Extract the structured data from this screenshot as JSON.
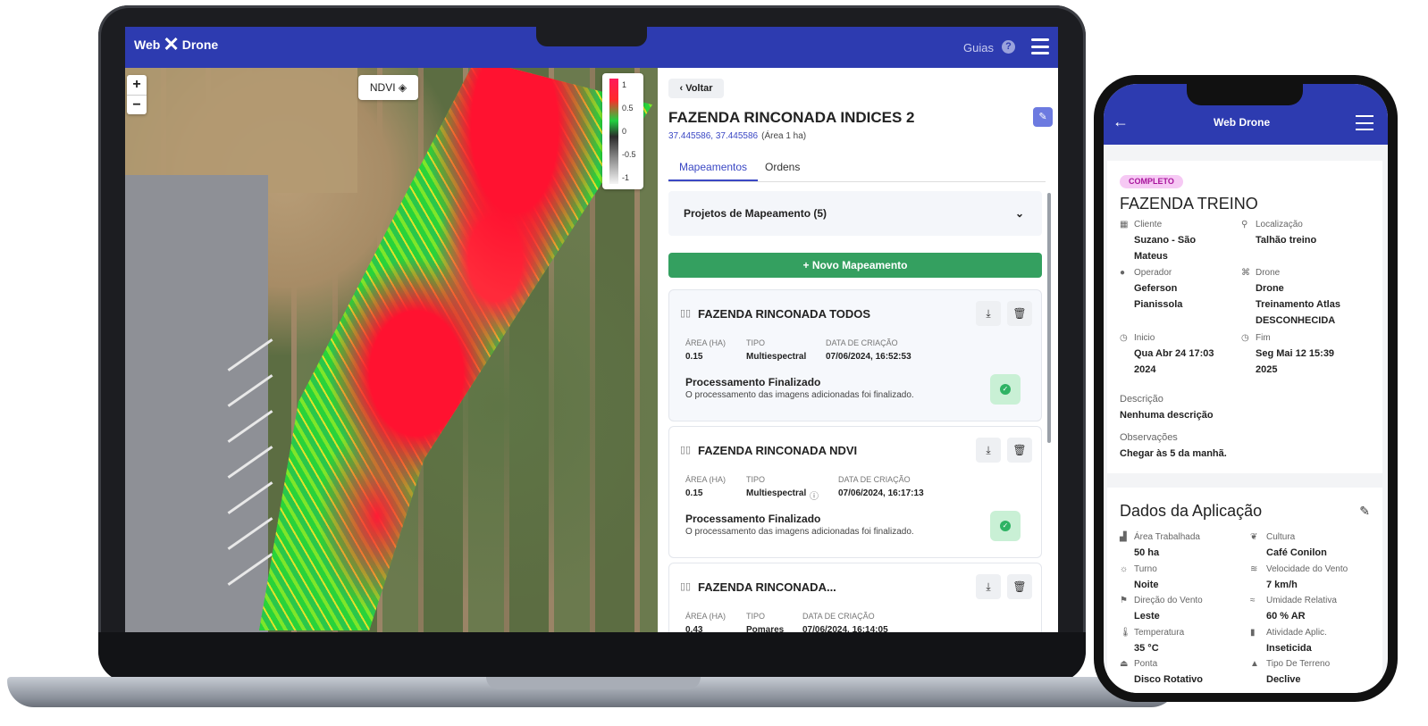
{
  "laptop": {
    "header": {
      "logo_left": "Web",
      "logo_right": "Drone",
      "guias": "Guias",
      "help": "?"
    },
    "map": {
      "zoom_in": "+",
      "zoom_out": "−",
      "layer": "NDVI",
      "legend": [
        "1",
        "0.5",
        "0",
        "-0.5",
        "-1"
      ]
    },
    "panel": {
      "back": "Voltar",
      "title": "FAZENDA RINCONADA INDICES 2",
      "coords": "37.445586, 37.445586",
      "area": "(Área 1 ha)",
      "tabs": [
        "Mapeamentos",
        "Ordens"
      ],
      "projects": "Projetos de Mapeamento (5)",
      "new_button": "Novo Mapeamento",
      "labels": {
        "area": "ÁREA (HA)",
        "tipo": "TIPO",
        "data": "DATA DE CRIAÇÃO"
      },
      "cards": [
        {
          "title": "FAZENDA RINCONADA TODOS",
          "area": "0.15",
          "tipo": "Multiespectral",
          "data": "07/06/2024, 16:52:53",
          "status": "Processamento Finalizado",
          "desc": "O processamento das imagens adicionadas foi finalizado."
        },
        {
          "title": "FAZENDA RINCONADA NDVI",
          "area": "0.15",
          "tipo": "Multiespectral",
          "data": "07/06/2024, 16:17:13",
          "status": "Processamento Finalizado",
          "desc": "O processamento das imagens adicionadas foi finalizado."
        },
        {
          "title": "FAZENDA RINCONADA...",
          "area": "0.43",
          "tipo": "Pomares",
          "data": "07/06/2024, 16:14:05"
        }
      ]
    }
  },
  "phone": {
    "header": {
      "logo": "Web Drone"
    },
    "badge": "COMPLETO",
    "title": "FAZENDA TREINO",
    "fields": {
      "cliente_l": "Cliente",
      "cliente_v1": "Suzano - São",
      "cliente_v2": "Mateus",
      "local_l": "Localização",
      "local_v": "Talhão  treino",
      "operador_l": "Operador",
      "operador_v1": "Geferson",
      "operador_v2": "Pianissola",
      "drone_l": "Drone",
      "drone_v1": "Drone",
      "drone_v2": "Treinamento Atlas",
      "drone_v3": "DESCONHECIDA",
      "inicio_l": "Inicio",
      "inicio_v1": "Qua Abr 24 17:03",
      "inicio_v2": "2024",
      "fim_l": "Fim",
      "fim_v1": "Seg Mai 12 15:39",
      "fim_v2": "2025",
      "desc_l": "Descrição",
      "desc_v": "Nenhuma descrição",
      "obs_l": "Observações",
      "obs_v": "Chegar às 5 da manhã."
    },
    "aplicacao": {
      "title": "Dados da Aplicação",
      "items": [
        {
          "l": "Área Trabalhada",
          "v": "50 ha"
        },
        {
          "l": "Cultura",
          "v": "Café Conilon"
        },
        {
          "l": "Turno",
          "v": "Noite"
        },
        {
          "l": "Velocidade do Vento",
          "v": "7 km/h"
        },
        {
          "l": "Direção do Vento",
          "v": "Leste"
        },
        {
          "l": "Umidade Relativa",
          "v": "60 % AR"
        },
        {
          "l": "Temperatura",
          "v": "35 °C"
        },
        {
          "l": "Atividade Aplic.",
          "v": "Inseticida"
        },
        {
          "l": "Ponta",
          "v": "Disco Rotativo"
        },
        {
          "l": "Tipo De Terreno",
          "v": "Declive"
        }
      ]
    }
  }
}
